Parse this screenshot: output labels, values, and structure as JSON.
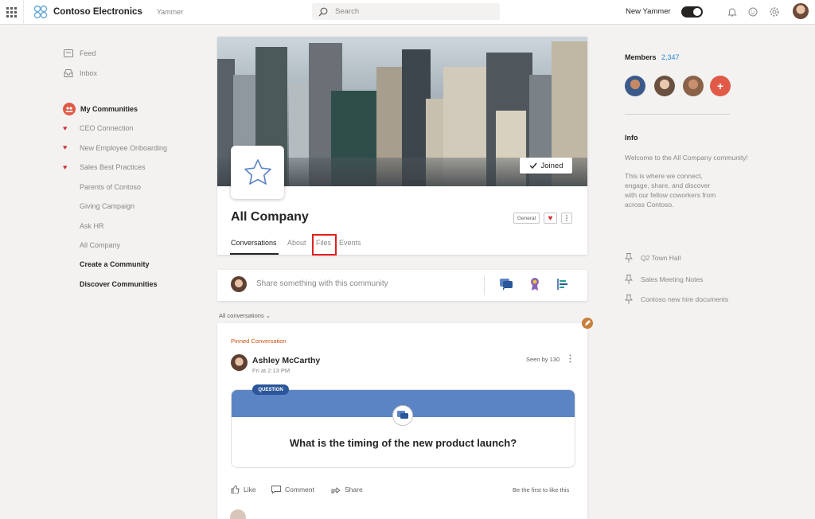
{
  "topbar": {
    "company": "Contoso Electronics",
    "app": "Yammer",
    "search_placeholder": "Search",
    "new_yammer": "New Yammer"
  },
  "nav": {
    "feed": "Feed",
    "inbox": "Inbox",
    "my_communities": "My Communities",
    "communities": [
      "CEO Connection",
      "New Employee Onboarding",
      "Sales Best Practices",
      "Parents of Contoso",
      "Giving Campaign",
      "Ask HR",
      "All Company"
    ],
    "create": "Create a Community",
    "discover": "Discover Communities"
  },
  "community": {
    "title": "All Company",
    "joined": "Joined",
    "chip": "General",
    "tabs": [
      "Conversations",
      "About",
      "Files",
      "Events"
    ]
  },
  "compose": {
    "placeholder": "Share something with this community"
  },
  "feed": {
    "filter": "All conversations",
    "pinned": "Pinned Conversation",
    "author": "Ashley McCarthy",
    "time": "Fri at 2:13 PM",
    "seen": "Seen by 130",
    "tag": "QUESTION",
    "question": "What is the timing of the new product launch?",
    "like": "Like",
    "comment": "Comment",
    "share": "Share",
    "first_like": "Be the first to like this"
  },
  "sidebar_right": {
    "members_label": "Members",
    "members_count": "2,347",
    "info_heading": "Info",
    "info_lines": [
      "Welcome to the All Company community!",
      "This is where we connect,",
      "engage, share, and discover",
      "with our fellow coworkers from",
      "across Contoso."
    ],
    "pinned_links": [
      "Q2 Town Hall",
      "Sales Meeting Notes",
      "Contoso new hire documents"
    ]
  },
  "colors": {
    "accent": "#5b84c4",
    "heart": "#d13438",
    "highlight": "#e02020"
  }
}
